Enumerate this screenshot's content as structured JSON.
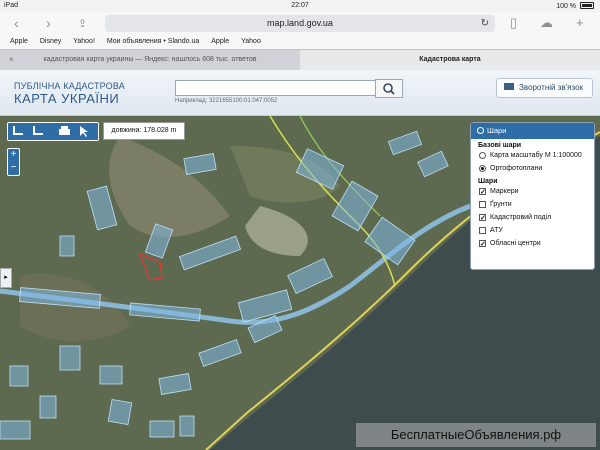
{
  "status_bar": {
    "carrier": "iPad",
    "time": "22:07",
    "battery": "100 %"
  },
  "browser": {
    "url": "map.land.gov.ua",
    "bookmarks": [
      "Apple",
      "Disney",
      "Yahoo!",
      "Мои объявления • Slando.ua",
      "Apple",
      "Yahoo"
    ],
    "tabs": [
      {
        "label": "кадастровая карта украины — Яндекс: нашлось 608 тыс. ответов",
        "active": false
      },
      {
        "label": "Кадастрова карта",
        "active": true
      }
    ]
  },
  "site": {
    "brand_line1": "ПУБЛІЧНА КАДАСТРОВА",
    "brand_line2": "КАРТА УКРАЇНИ",
    "search_placeholder": "",
    "search_hint": "Наприклад: 3221655100:01:047:0052",
    "feedback_label": "Зворотній зв'язок"
  },
  "map": {
    "measure_readout": "довжина: 178.028 m",
    "side_tab": "▸",
    "watermark": "БесплатныеОбъявления.рф",
    "zoom_in": "+",
    "zoom_out": "−"
  },
  "layers_panel": {
    "title": "Шари",
    "base_title": "Базові шари",
    "base_layers": [
      {
        "label": "Карта масштабу М 1:100000",
        "selected": false
      },
      {
        "label": "Ортофотоплани",
        "selected": true
      }
    ],
    "overlay_title": "Шари",
    "overlays": [
      {
        "label": "Маркери",
        "checked": true
      },
      {
        "label": "Ґрунти",
        "checked": false
      },
      {
        "label": "Кадастровий поділ",
        "checked": true
      },
      {
        "label": "АТУ",
        "checked": false
      },
      {
        "label": "Обласні центри",
        "checked": true
      }
    ]
  },
  "colors": {
    "accent": "#2e6da5",
    "parcel": "#7fb6e2",
    "sea": "#3f4c4e",
    "coast_line": "#e2d15b"
  }
}
